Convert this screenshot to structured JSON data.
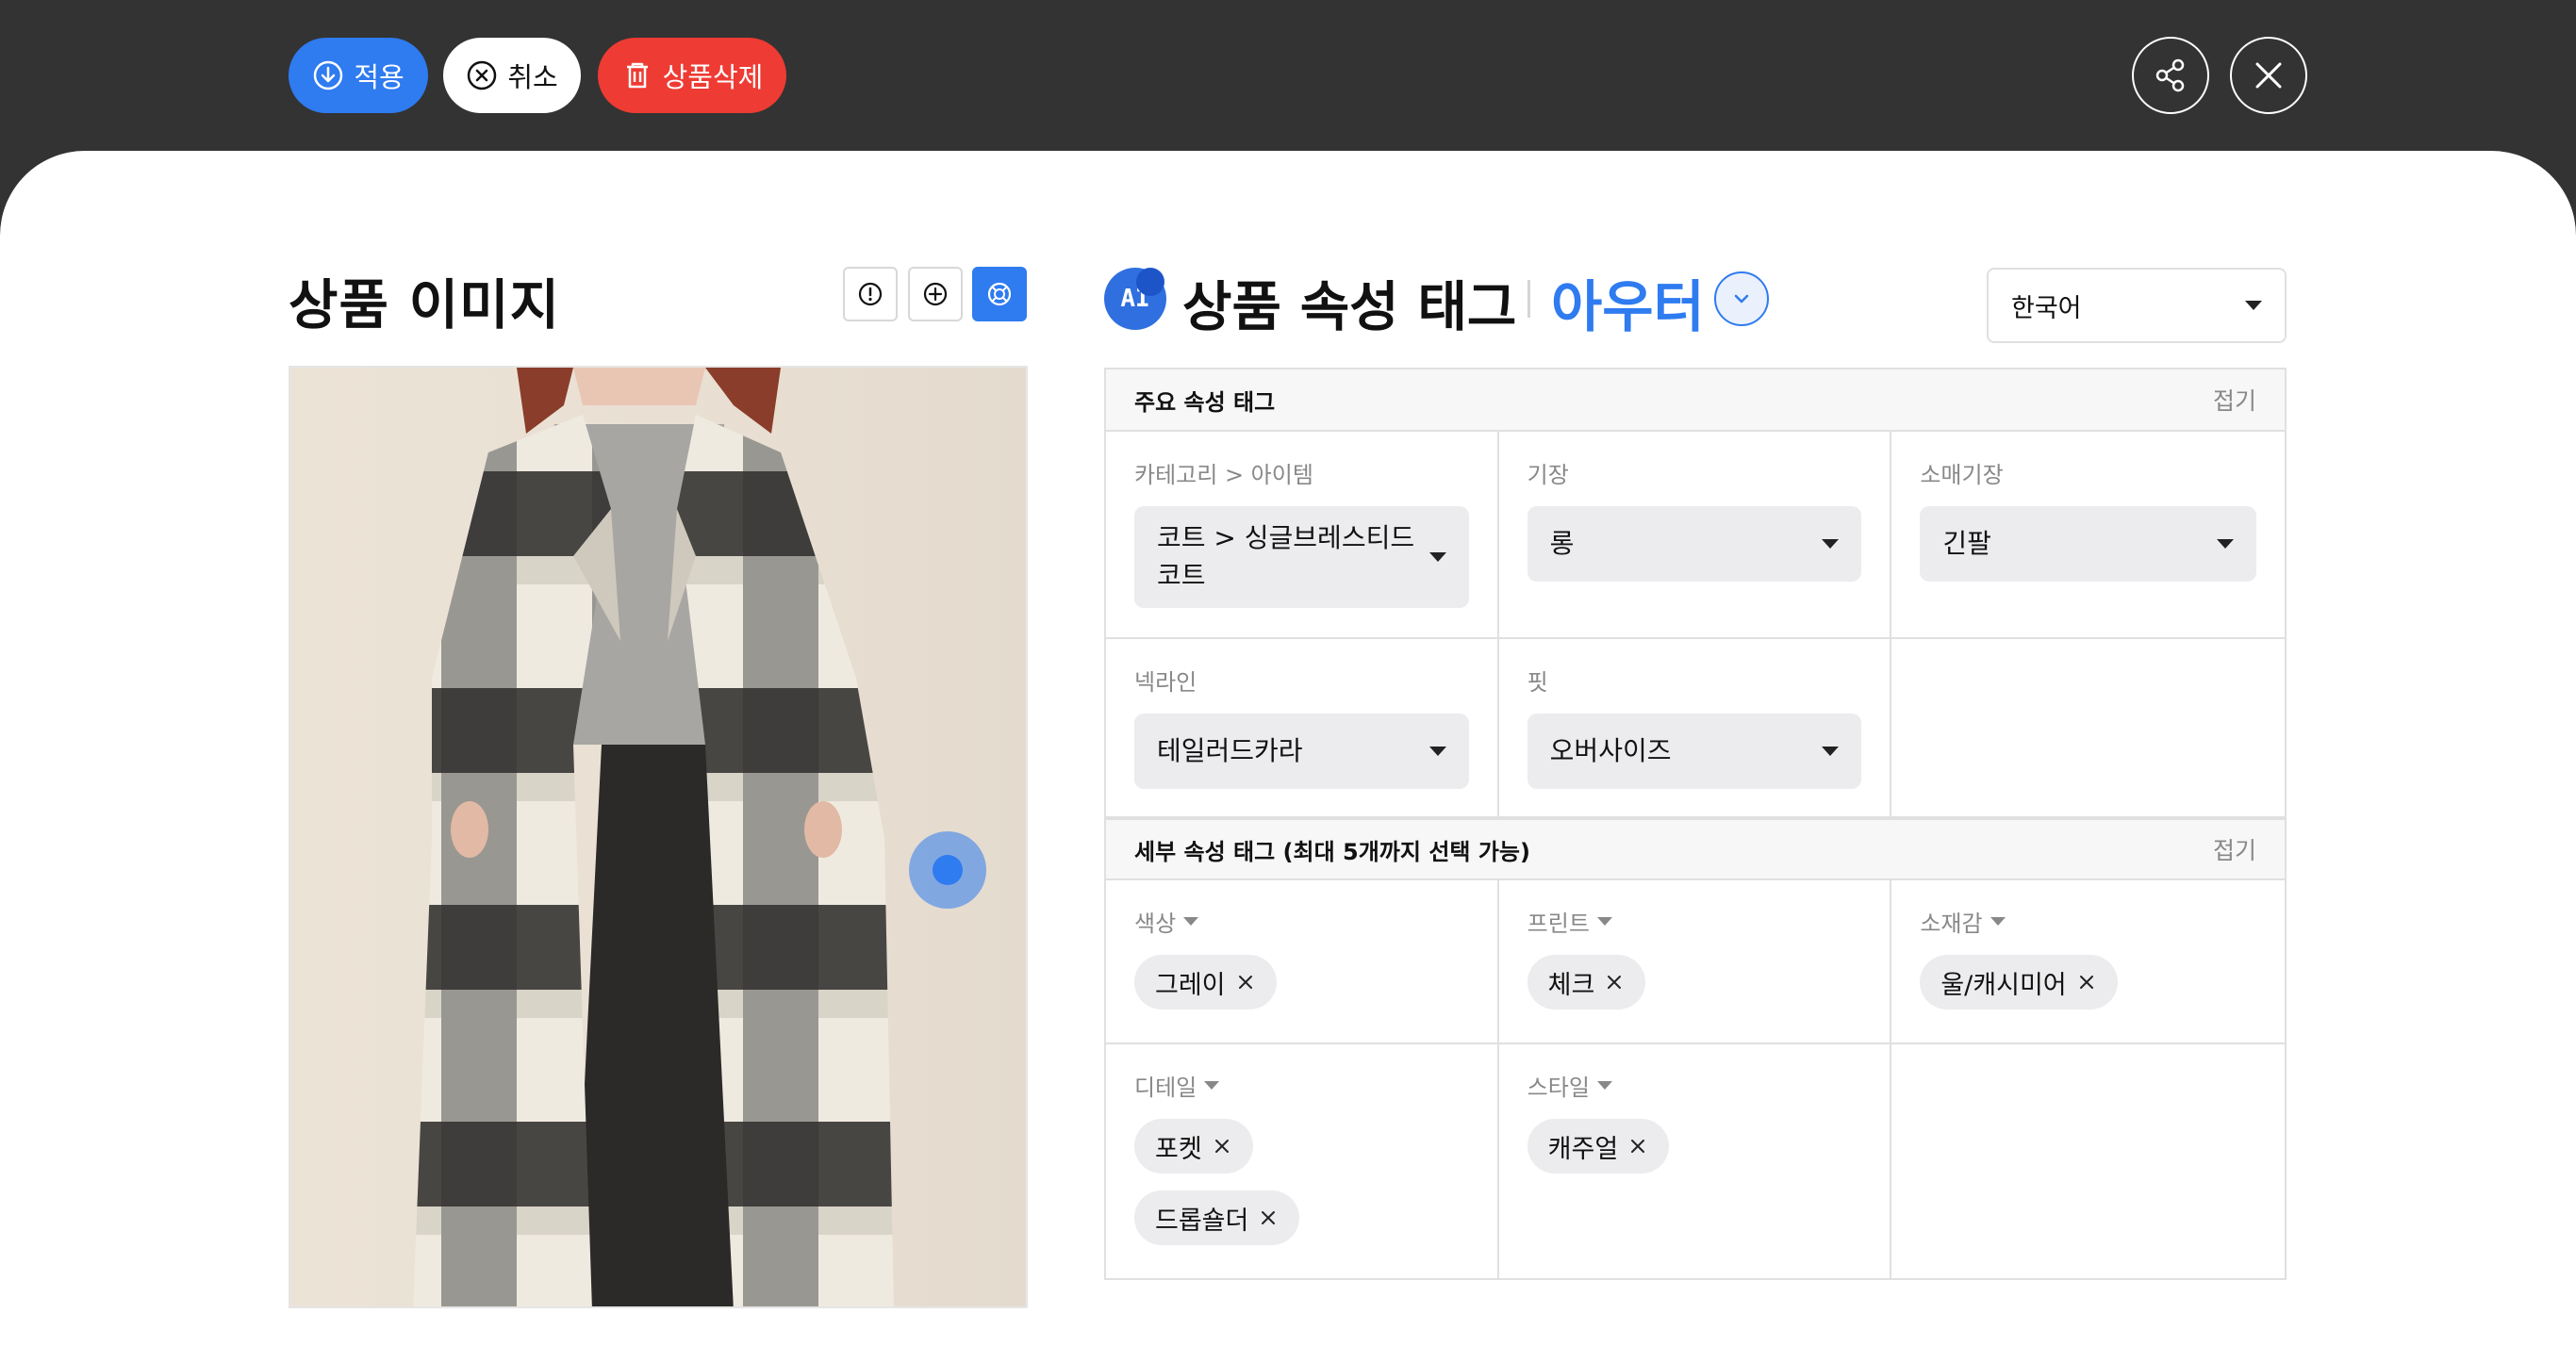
{
  "toolbar": {
    "apply_label": "적용",
    "cancel_label": "취소",
    "delete_label": "상품삭제",
    "share_icon": "share-icon",
    "close_icon": "close-icon"
  },
  "image_panel": {
    "title": "상품 이미지",
    "tools": [
      "info-icon",
      "add-icon",
      "target-icon"
    ]
  },
  "attr_panel": {
    "ai_badge": "AI",
    "title": "상품 속성 태그",
    "category": "아우터",
    "language": "한국어"
  },
  "main_section": {
    "title": "주요 속성 태그",
    "collapse_label": "접기",
    "fields": [
      {
        "label": "카테고리 > 아이템",
        "value": "코트 > 싱글브레스티드 코트"
      },
      {
        "label": "기장",
        "value": "롱"
      },
      {
        "label": "소매기장",
        "value": "긴팔"
      },
      {
        "label": "넥라인",
        "value": "테일러드카라"
      },
      {
        "label": "핏",
        "value": "오버사이즈"
      }
    ]
  },
  "detail_section": {
    "title": "세부 속성 태그 (최대 5개까지 선택 가능)",
    "collapse_label": "접기",
    "fields": [
      {
        "label": "색상",
        "tags": [
          "그레이"
        ]
      },
      {
        "label": "프린트",
        "tags": [
          "체크"
        ]
      },
      {
        "label": "소재감",
        "tags": [
          "울/캐시미어"
        ]
      },
      {
        "label": "디테일",
        "tags": [
          "포켓",
          "드롭숄더"
        ]
      },
      {
        "label": "스타일",
        "tags": [
          "캐주얼"
        ]
      }
    ]
  },
  "colors": {
    "topbar": "#333333",
    "accent": "#2f7bf0",
    "danger": "#ee3b33",
    "chip_bg": "#ececee"
  }
}
